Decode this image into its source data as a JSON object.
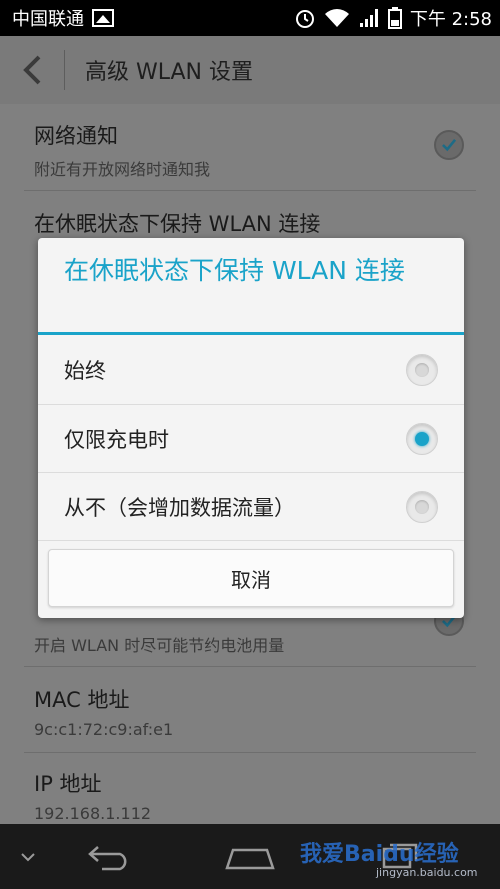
{
  "status_bar": {
    "carrier": "中国联通",
    "time": "下午 2:58"
  },
  "action_bar": {
    "title": "高级 WLAN 设置"
  },
  "settings": {
    "network_notify": {
      "title": "网络通知",
      "subtitle": "附近有开放网络时通知我"
    },
    "keep_wlan": {
      "title": "在休眠状态下保持 WLAN 连接"
    },
    "battery_hint": {
      "subtitle": "开启 WLAN 时尽可能节约电池用量"
    },
    "mac": {
      "title": "MAC 地址",
      "value": "9c:c1:72:c9:af:e1"
    },
    "ip": {
      "title": "IP 地址",
      "value": "192.168.1.112"
    }
  },
  "dialog": {
    "title": "在休眠状态下保持 WLAN 连接",
    "options": [
      {
        "label": "始终",
        "selected": false
      },
      {
        "label": "仅限充电时",
        "selected": true
      },
      {
        "label": "从不（会增加数据流量）",
        "selected": false
      }
    ],
    "cancel_label": "取消"
  },
  "watermark": {
    "text": "我爱Baidu经验",
    "url": "jingyan.baidu.com"
  },
  "colors": {
    "accent": "#1aa3c9",
    "status_bar": "#000000",
    "nav_bar": "#1a1a1a"
  }
}
